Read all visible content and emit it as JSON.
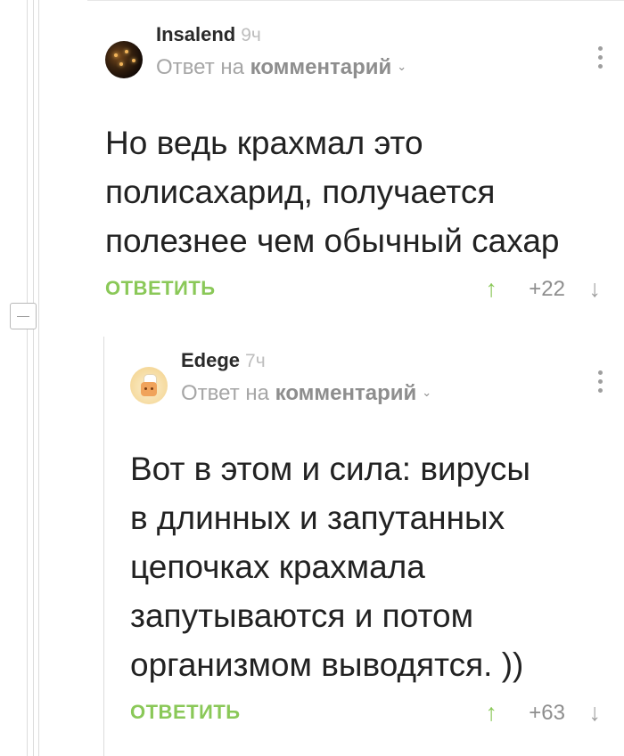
{
  "comments": [
    {
      "username": "Insalend",
      "time": "9ч",
      "reply_prefix": "Ответ на",
      "reply_link": "комментарий",
      "body": "Но ведь крахмал это\nполисахарид, получается\nполезнее чем обычный сахар",
      "reply_label": "ОТВЕТИТЬ",
      "score": "+22",
      "up_icon": "arrow-up-icon",
      "down_icon": "arrow-down-icon"
    },
    {
      "username": "Edege",
      "time": "7ч",
      "reply_prefix": "Ответ на",
      "reply_link": "комментарий",
      "body": "Вот в этом и сила: вирусы\nв длинных и запутанных\nцепочках крахмала\nзапутываются и потом\nорганизмом выводятся. ))",
      "reply_label": "ОТВЕТИТЬ",
      "score": "+63",
      "up_icon": "arrow-up-icon",
      "down_icon": "arrow-down-icon"
    }
  ],
  "colors": {
    "accent_green": "#8ac858",
    "muted_text": "#a6a6a6",
    "thread_line": "#dcdcdc"
  },
  "icons": {
    "collapse": "collapse-minus-icon",
    "more": "more-vertical-icon",
    "chevron": "chevron-down-icon"
  }
}
